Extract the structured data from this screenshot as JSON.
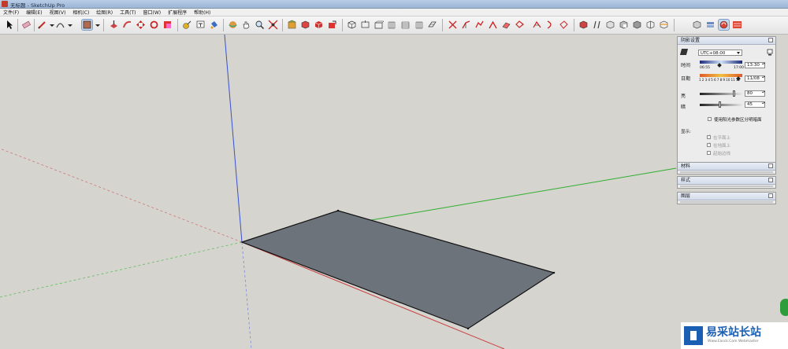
{
  "window": {
    "title": "无标题 - SketchUp Pro"
  },
  "menu": [
    "文件(F)",
    "编辑(E)",
    "视图(V)",
    "相机(C)",
    "绘图(R)",
    "工具(T)",
    "窗口(W)",
    "扩展程序",
    "帮助(H)"
  ],
  "colors": {
    "axis_blue": "#3a4fd0",
    "axis_green": "#2fae2f",
    "axis_red": "#c84040",
    "face": "#6d737b",
    "edge": "#111111"
  },
  "shadow_panel": {
    "title": "阴影设置",
    "timezone": "UTC+08:00",
    "time_label": "时间",
    "time_start": "06:55",
    "time_end": "17:00",
    "time_value": "13:30",
    "date_label": "日期",
    "months": "1 2 3 4 5 6 7 8 9 10 11 12",
    "date_value": "11/08",
    "light_label": "亮",
    "light_value": "80",
    "dark_label": "暗",
    "dark_value": "45",
    "sun_shading_label": "使用阳光参数区分明暗面",
    "display_label": "显示:",
    "opt_on_faces": "在平面上",
    "opt_on_ground": "在地面上",
    "opt_from_edges": "起始边线"
  },
  "collapsed_panels": [
    "材料",
    "样式",
    "图层"
  ],
  "watermark": {
    "title": "易采站长站",
    "url": "Www.Easck.Com  Webmaster"
  }
}
